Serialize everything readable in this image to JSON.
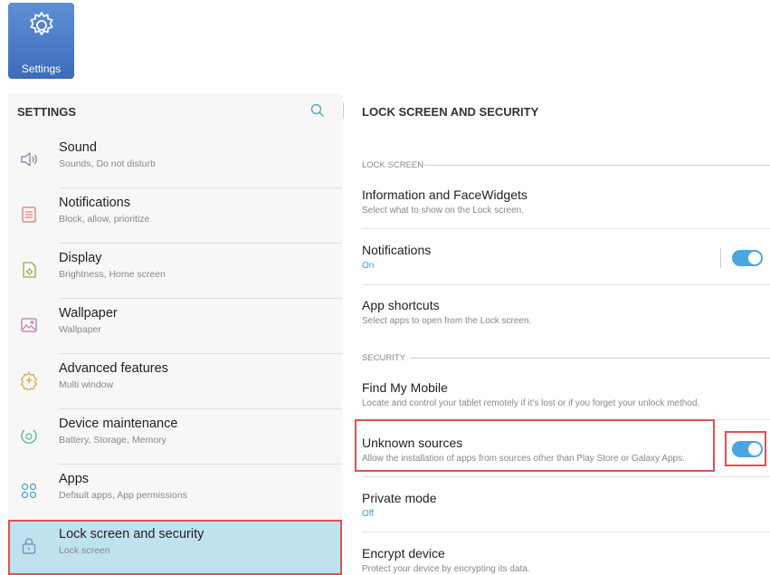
{
  "app_icon": {
    "label": "Settings"
  },
  "left_panel": {
    "title": "SETTINGS",
    "items": [
      {
        "title": "Sound",
        "subtitle": "Sounds, Do not disturb",
        "icon": "speaker-icon"
      },
      {
        "title": "Notifications",
        "subtitle": "Block, allow, prioritize",
        "icon": "notifications-icon"
      },
      {
        "title": "Display",
        "subtitle": "Brightness, Home screen",
        "icon": "display-icon"
      },
      {
        "title": "Wallpaper",
        "subtitle": "Wallpaper",
        "icon": "wallpaper-icon"
      },
      {
        "title": "Advanced features",
        "subtitle": "Multi window",
        "icon": "advanced-features-icon"
      },
      {
        "title": "Device maintenance",
        "subtitle": "Battery, Storage, Memory",
        "icon": "device-maintenance-icon"
      },
      {
        "title": "Apps",
        "subtitle": "Default apps, App permissions",
        "icon": "apps-icon"
      },
      {
        "title": "Lock screen and security",
        "subtitle": "Lock screen",
        "icon": "lock-icon",
        "selected": true
      }
    ]
  },
  "right_panel": {
    "title": "LOCK SCREEN AND SECURITY",
    "sections": {
      "lock_screen": "LOCK SCREEN",
      "security": "SECURITY"
    },
    "items": {
      "info_facewidgets": {
        "title": "Information and FaceWidgets",
        "subtitle": "Select what to show on the Lock screen."
      },
      "notifications": {
        "title": "Notifications",
        "subtitle": "On",
        "toggle_on": true
      },
      "app_shortcuts": {
        "title": "App shortcuts",
        "subtitle": "Select apps to open from the Lock screen."
      },
      "find_my_mobile": {
        "title": "Find My Mobile",
        "subtitle": "Locate and control your tablet remotely if it's lost or if you forget your unlock method."
      },
      "unknown_sources": {
        "title": "Unknown sources",
        "subtitle": "Allow the installation of apps from sources other than Play Store or Galaxy Apps.",
        "toggle_on": true
      },
      "private_mode": {
        "title": "Private mode",
        "subtitle": "Off"
      },
      "encrypt_device": {
        "title": "Encrypt device",
        "subtitle": "Protect your device by encrypting its data."
      }
    }
  },
  "colors": {
    "accent": "#4aa6e0",
    "selected_bg": "#bfe2ef",
    "highlight": "#e25050"
  }
}
